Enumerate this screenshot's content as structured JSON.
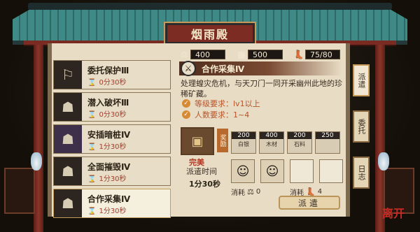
{
  "title": "烟雨殿",
  "resources": [
    {
      "icon": "silver-icon",
      "glyph": "⚖",
      "value": "400"
    },
    {
      "icon": "wood-icon",
      "glyph": "▦",
      "value": "500"
    },
    {
      "icon": "boot-icon",
      "glyph": "👢",
      "value": "75/80"
    }
  ],
  "tasks": [
    {
      "name": "委托保护Ⅲ",
      "time": "0分30秒",
      "glyph": "⚐",
      "style": "dark"
    },
    {
      "name": "潜入破坏Ⅲ",
      "time": "0分30秒",
      "glyph": "☗",
      "style": "dark"
    },
    {
      "name": "安插暗桩Ⅳ",
      "time": "1分30秒",
      "glyph": "☗",
      "style": "purple"
    },
    {
      "name": "全面摧毁Ⅳ",
      "time": "1分30秒",
      "glyph": "☗",
      "style": "dark"
    },
    {
      "name": "合作采集Ⅳ",
      "time": "1分30秒",
      "glyph": "☗",
      "style": "dark"
    }
  ],
  "detail": {
    "title": "合作采集Ⅳ",
    "description": "处理蝗灾危机，与天刀门一同开采幽州此地的珍稀矿藏。",
    "requirements": [
      {
        "label": "等级要求：lv1以上"
      },
      {
        "label": "人数要求：1~4"
      }
    ],
    "reward_tag": "奖励",
    "chest_label": "完美",
    "rewards": [
      {
        "num": "200",
        "label": "白银"
      },
      {
        "num": "400",
        "label": "木材"
      },
      {
        "num": "200",
        "label": "石料"
      },
      {
        "num": "250",
        "label": ""
      }
    ],
    "dispatch_label": "派遣时间",
    "dispatch_time": "1分30秒",
    "cost_label_1": "消耗",
    "cost_value_1": "0",
    "cost_label_2": "消耗",
    "cost_value_2": "4",
    "go_button": "派遣"
  },
  "side_tabs": [
    "派遣",
    "委托",
    "日志"
  ],
  "brand": "离开"
}
